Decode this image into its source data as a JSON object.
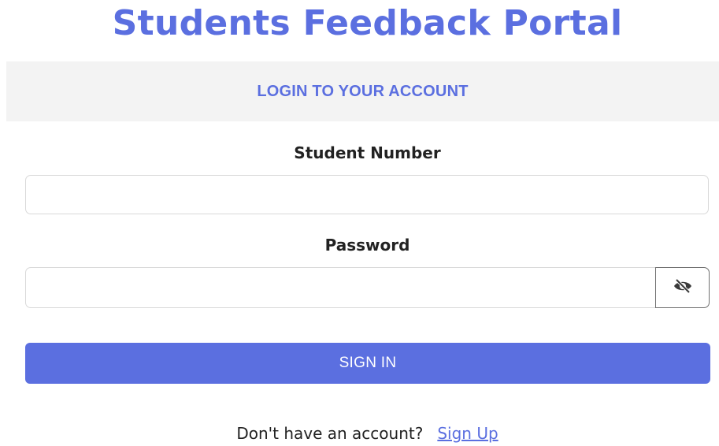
{
  "page": {
    "title": "Students Feedback Portal"
  },
  "card": {
    "header": "LOGIN TO YOUR ACCOUNT"
  },
  "form": {
    "student_number_label": "Student Number",
    "student_number_value": "",
    "password_label": "Password",
    "password_value": "",
    "password_toggle_icon": "eye-slash-icon",
    "submit_label": "SIGN IN"
  },
  "footer": {
    "prompt": "Don't have an account?",
    "signup_link": "Sign Up"
  },
  "colors": {
    "accent": "#5b6fe0",
    "header_bg": "#f3f3f3",
    "text": "#222222"
  }
}
